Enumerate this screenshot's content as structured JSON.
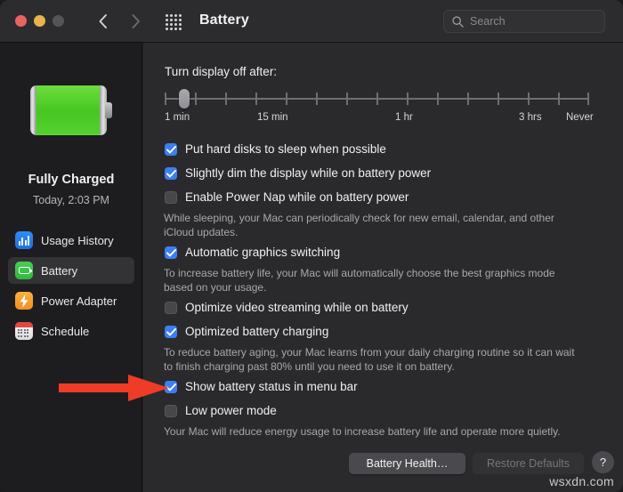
{
  "window": {
    "title": "Battery",
    "traffic_lights": [
      "close",
      "minimize",
      "zoom"
    ],
    "back_label": "Back",
    "forward_label": "Forward",
    "grid_label": "Show All"
  },
  "search": {
    "placeholder": "Search",
    "value": ""
  },
  "sidebar": {
    "battery_status": "Fully Charged",
    "battery_time": "Today, 2:03 PM",
    "items": [
      {
        "label": "Usage History",
        "icon": "bar-chart-icon",
        "selected": false
      },
      {
        "label": "Battery",
        "icon": "battery-icon",
        "selected": true
      },
      {
        "label": "Power Adapter",
        "icon": "bolt-icon",
        "selected": false
      },
      {
        "label": "Schedule",
        "icon": "calendar-icon",
        "selected": false
      }
    ]
  },
  "main": {
    "slider": {
      "label": "Turn display off after:",
      "tick_labels": [
        "1 min",
        "15 min",
        "1 hr",
        "3 hrs",
        "Never"
      ],
      "value": "1 min",
      "ticks": 15
    },
    "options": [
      {
        "label": "Put hard disks to sleep when possible",
        "checked": true,
        "description": ""
      },
      {
        "label": "Slightly dim the display while on battery power",
        "checked": true,
        "description": ""
      },
      {
        "label": "Enable Power Nap while on battery power",
        "checked": false,
        "description": "While sleeping, your Mac can periodically check for new email, calendar, and other iCloud updates."
      },
      {
        "label": "Automatic graphics switching",
        "checked": true,
        "description": "To increase battery life, your Mac will automatically choose the best graphics mode based on your usage."
      },
      {
        "label": "Optimize video streaming while on battery",
        "checked": false,
        "description": ""
      },
      {
        "label": "Optimized battery charging",
        "checked": true,
        "description": "To reduce battery aging, your Mac learns from your daily charging routine so it can wait to finish charging past 80% until you need to use it on battery."
      },
      {
        "label": "Show battery status in menu bar",
        "checked": true,
        "description": ""
      },
      {
        "label": "Low power mode",
        "checked": false,
        "description": "Your Mac will reduce energy usage to increase battery life and operate more quietly."
      }
    ],
    "buttons": {
      "battery_health": "Battery Health…",
      "restore_defaults": "Restore Defaults",
      "help": "?"
    }
  },
  "annotation": {
    "arrow_color": "#ee3c26",
    "arrow_target": "Show battery status in menu bar"
  },
  "watermark": "wsxdn.com",
  "colors": {
    "accent_blue": "#3b7ff0",
    "battery_green": "#46c721",
    "sidebar_bg": "#1d1d1f",
    "main_bg": "#2a2a2c",
    "titlebar_bg": "#2c2c2e"
  }
}
